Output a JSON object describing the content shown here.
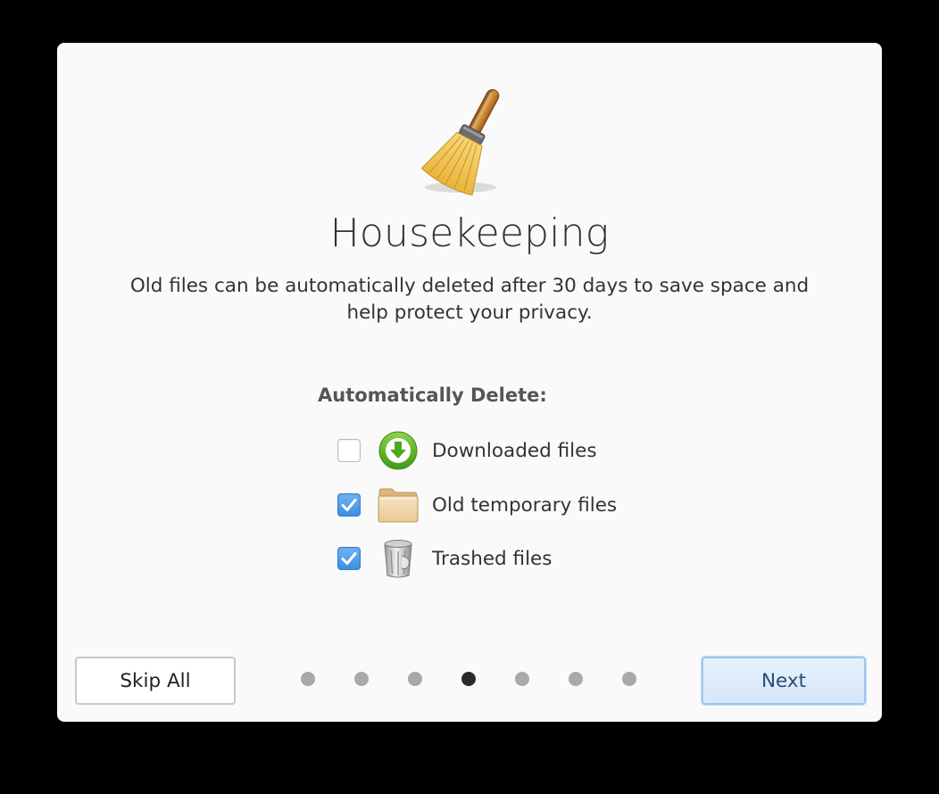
{
  "dialog": {
    "hero_icon": "broom-icon",
    "title": "Housekeeping",
    "description": "Old files can be automatically deleted after 30 days to save space and help protect your privacy.",
    "section_heading": "Automatically Delete:",
    "options": [
      {
        "label": "Downloaded files",
        "checked": false,
        "icon": "download-arrow-icon"
      },
      {
        "label": "Old temporary files",
        "checked": true,
        "icon": "folder-icon"
      },
      {
        "label": "Trashed files",
        "checked": true,
        "icon": "trash-can-icon"
      }
    ]
  },
  "footer": {
    "skip_label": "Skip All",
    "next_label": "Next",
    "page_count": 7,
    "current_page": 4
  },
  "colors": {
    "accent": "#3f8fe0",
    "dialog_background": "#fafafa",
    "active_dot": "#2b2b2b",
    "inactive_dot": "#a9a9a9"
  }
}
